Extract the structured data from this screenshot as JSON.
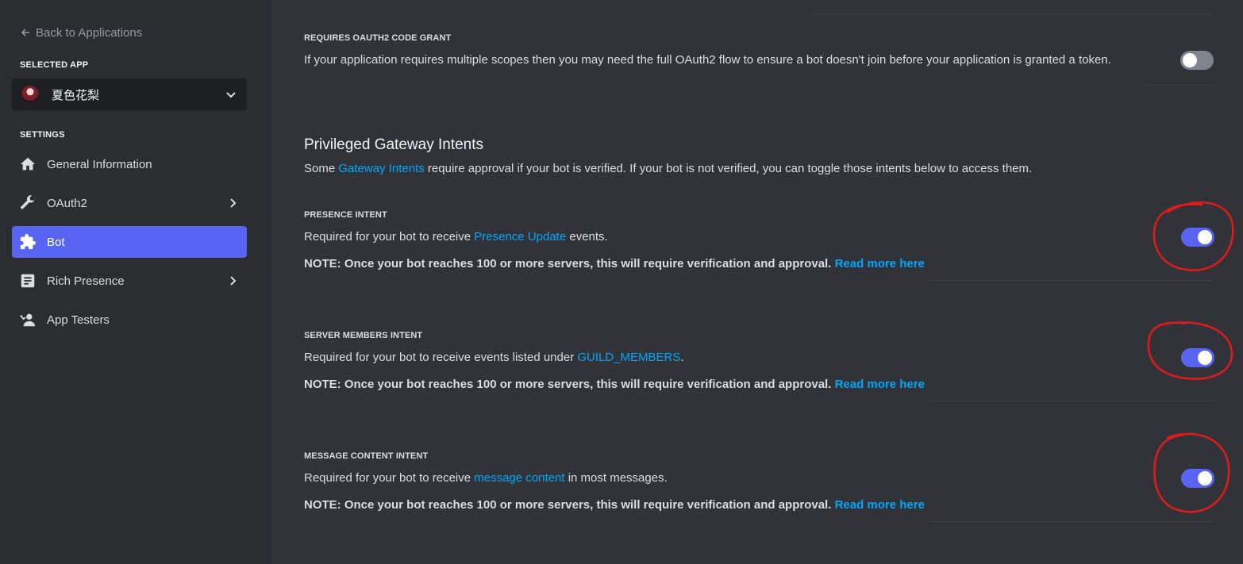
{
  "sidebar": {
    "back_label": "Back to Applications",
    "selected_app_label": "SELECTED APP",
    "app_name": "夏色花梨",
    "settings_label": "SETTINGS",
    "items": [
      {
        "label": "General Information",
        "icon": "home-icon"
      },
      {
        "label": "OAuth2",
        "icon": "wrench-icon",
        "has_chevron": true
      },
      {
        "label": "Bot",
        "icon": "puzzle-icon",
        "active": true
      },
      {
        "label": "Rich Presence",
        "icon": "document-icon",
        "has_chevron": true
      },
      {
        "label": "App Testers",
        "icon": "person-icon"
      }
    ]
  },
  "main": {
    "oauth2_grant": {
      "title": "REQUIRES OAUTH2 CODE GRANT",
      "description": "If your application requires multiple scopes then you may need the full OAuth2 flow to ensure a bot doesn't join before your application is granted a token.",
      "enabled": false
    },
    "intents": {
      "heading": "Privileged Gateway Intents",
      "desc_prefix": "Some ",
      "desc_link": "Gateway Intents",
      "desc_suffix": " require approval if your bot is verified. If your bot is not verified, you can toggle those intents below to access them."
    },
    "presence": {
      "title": "PRESENCE INTENT",
      "desc_prefix": "Required for your bot to receive ",
      "desc_link": "Presence Update",
      "desc_suffix": " events.",
      "note": "NOTE: Once your bot reaches 100 or more servers, this will require verification and approval. ",
      "note_link": "Read more here",
      "enabled": true
    },
    "members": {
      "title": "SERVER MEMBERS INTENT",
      "desc_prefix": "Required for your bot to receive events listed under ",
      "desc_link": "GUILD_MEMBERS",
      "desc_suffix": ".",
      "note": "NOTE: Once your bot reaches 100 or more servers, this will require verification and approval. ",
      "note_link": "Read more here",
      "enabled": true
    },
    "message": {
      "title": "MESSAGE CONTENT INTENT",
      "desc_prefix": "Required for your bot to receive ",
      "desc_link": "message content",
      "desc_suffix": " in most messages.",
      "note": "NOTE: Once your bot reaches 100 or more servers, this will require verification and approval. ",
      "note_link": "Read more here",
      "enabled": true
    }
  },
  "colors": {
    "accent": "#5865f2",
    "link": "#00a8fc",
    "annotation": "#e01b1b"
  }
}
